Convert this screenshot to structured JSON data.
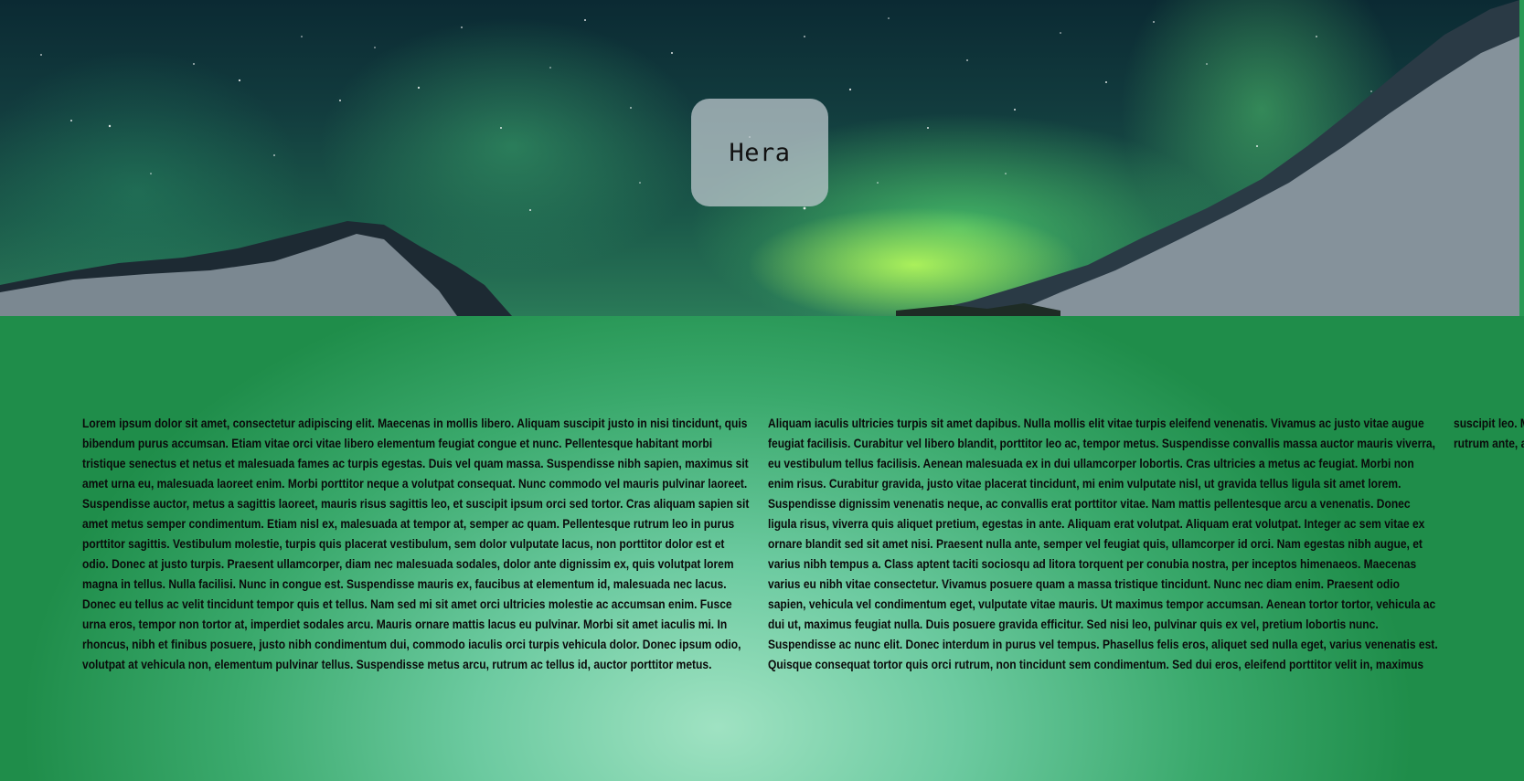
{
  "hero": {
    "title": "Hera"
  },
  "content": {
    "paragraph": "Lorem ipsum dolor sit amet, consectetur adipiscing elit. Maecenas in mollis libero. Aliquam suscipit justo in nisi tincidunt, quis bibendum purus accumsan. Etiam vitae orci vitae libero elementum feugiat congue et nunc. Pellentesque habitant morbi tristique senectus et netus et malesuada fames ac turpis egestas. Duis vel quam massa. Suspendisse nibh sapien, maximus sit amet urna eu, malesuada laoreet enim. Morbi porttitor neque a volutpat consequat. Nunc commodo vel mauris pulvinar laoreet. Suspendisse auctor, metus a sagittis laoreet, mauris risus sagittis leo, et suscipit ipsum orci sed tortor. Cras aliquam sapien sit amet metus semper condimentum. Etiam nisl ex, malesuada at tempor at, semper ac quam. Pellentesque rutrum leo in purus porttitor sagittis. Vestibulum molestie, turpis quis placerat vestibulum, sem dolor vulputate lacus, non porttitor dolor est et odio. Donec at justo turpis. Praesent ullamcorper, diam nec malesuada sodales, dolor ante dignissim ex, quis volutpat lorem magna in tellus. Nulla facilisi. Nunc in congue est. Suspendisse mauris ex, faucibus at elementum id, malesuada nec lacus. Donec eu tellus ac velit tincidunt tempor quis et tellus. Nam sed mi sit amet orci ultricies molestie ac accumsan enim. Fusce urna eros, tempor non tortor at, imperdiet sodales arcu. Mauris ornare mattis lacus eu pulvinar. Morbi sit amet iaculis mi. In rhoncus, nibh et finibus posuere, justo nibh condimentum dui, commodo iaculis orci turpis vehicula dolor. Donec ipsum odio, volutpat at vehicula non, elementum pulvinar tellus. Suspendisse metus arcu, rutrum ac tellus id, auctor porttitor metus. Aliquam iaculis ultricies turpis sit amet dapibus. Nulla mollis elit vitae turpis eleifend venenatis. Vivamus ac justo vitae augue feugiat facilisis. Curabitur vel libero blandit, porttitor leo ac, tempor metus. Suspendisse convallis massa auctor mauris viverra, eu vestibulum tellus facilisis. Aenean malesuada ex in dui ullamcorper lobortis. Cras ultricies a metus ac feugiat. Morbi non enim risus. Curabitur gravida, justo vitae placerat tincidunt, mi enim vulputate nisl, ut gravida tellus ligula sit amet lorem. Suspendisse dignissim venenatis neque, ac convallis erat porttitor vitae. Nam mattis pellentesque arcu a venenatis. Donec ligula risus, viverra quis aliquet pretium, egestas in ante. Aliquam erat volutpat. Aliquam erat volutpat. Integer ac sem vitae ex ornare blandit sed sit amet nisi. Praesent nulla ante, semper vel feugiat quis, ullamcorper id orci. Nam egestas nibh augue, et varius nibh tempus a. Class aptent taciti sociosqu ad litora torquent per conubia nostra, per inceptos himenaeos. Maecenas varius eu nibh vitae consectetur. Vivamus posuere quam a massa tristique tincidunt. Nunc nec diam enim. Praesent odio sapien, vehicula vel condimentum eget, vulputate vitae mauris. Ut maximus tempor accumsan. Aenean tortor tortor, vehicula ac dui ut, maximus feugiat nulla. Duis posuere gravida efficitur. Sed nisi leo, pulvinar quis ex vel, pretium lobortis nunc. Suspendisse ac nunc elit. Donec interdum in purus vel tempus. Phasellus felis eros, aliquet sed nulla eget, varius venenatis est. Quisque consequat tortor quis orci rutrum, non tincidunt sem condimentum. Sed dui eros, eleifend porttitor velit in, maximus suscipit leo. Maecenas id leo tempor, aliquet leo a, lobortis velit. Aenean imperdiet, diam sed aliquet malesuada, ligula sapien rutrum ante, at mattis lorem nulla non purus. Ut id fermentum nibh."
  }
}
